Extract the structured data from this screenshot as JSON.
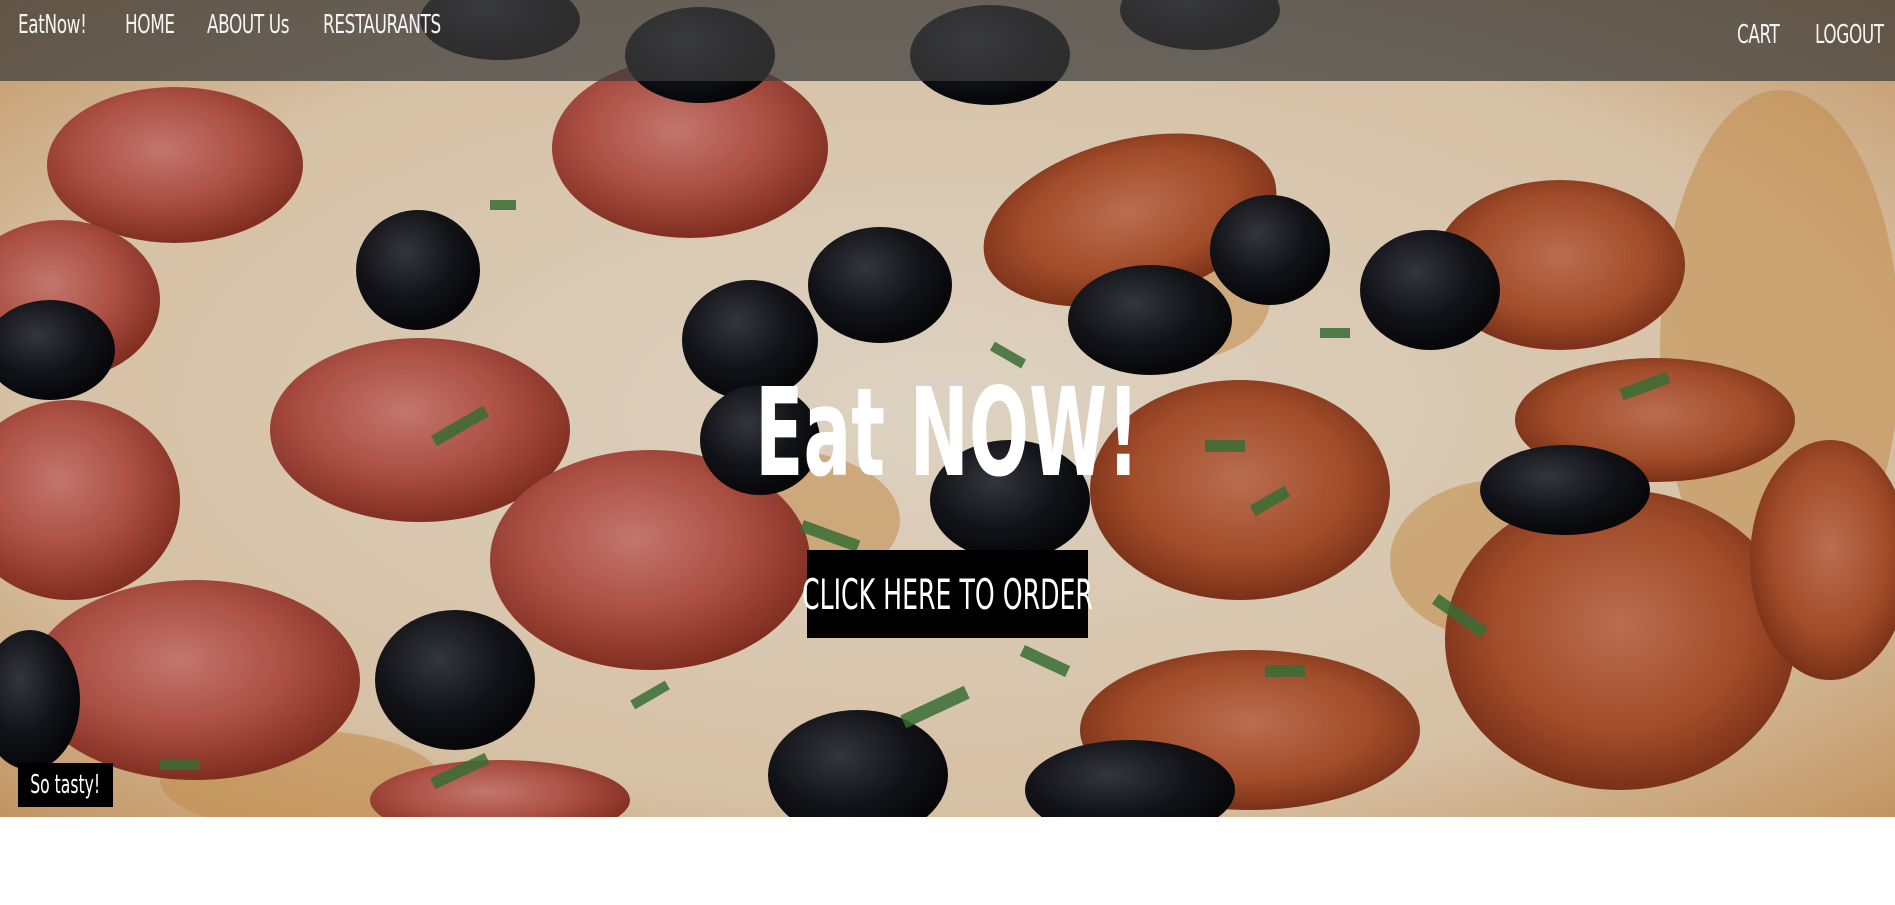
{
  "navbar": {
    "brand": "EatNow!",
    "links": [
      "HOME",
      "ABOUT Us",
      "RESTAURANTS"
    ],
    "right_links": [
      "CART",
      "LOGOUT"
    ]
  },
  "hero": {
    "title": "Eat NOW!",
    "cta_label": "CLICK HERE TO ORDER",
    "caption": "So tasty!"
  },
  "colors": {
    "navbar_bg": "#3c3c3c",
    "button_bg": "#000000",
    "text": "#ffffff"
  }
}
